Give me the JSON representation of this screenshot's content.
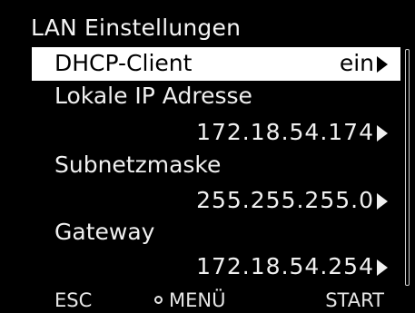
{
  "screen": {
    "title": "LAN Einstellungen"
  },
  "menu": {
    "items": [
      {
        "label": "DHCP-Client",
        "value": "ein",
        "selected": true
      },
      {
        "label": "Lokale IP Adresse",
        "value": "172.18.54.174"
      },
      {
        "label": "Subnetzmaske",
        "value": "255.255.255.0"
      },
      {
        "label": "Gateway",
        "value": "172.18.54.254"
      }
    ]
  },
  "softkeys": {
    "left": "ESC",
    "center": "MENÜ",
    "right": "START"
  },
  "icons": {
    "submenu": "arrow-right-icon",
    "center_key": "circle-icon"
  }
}
